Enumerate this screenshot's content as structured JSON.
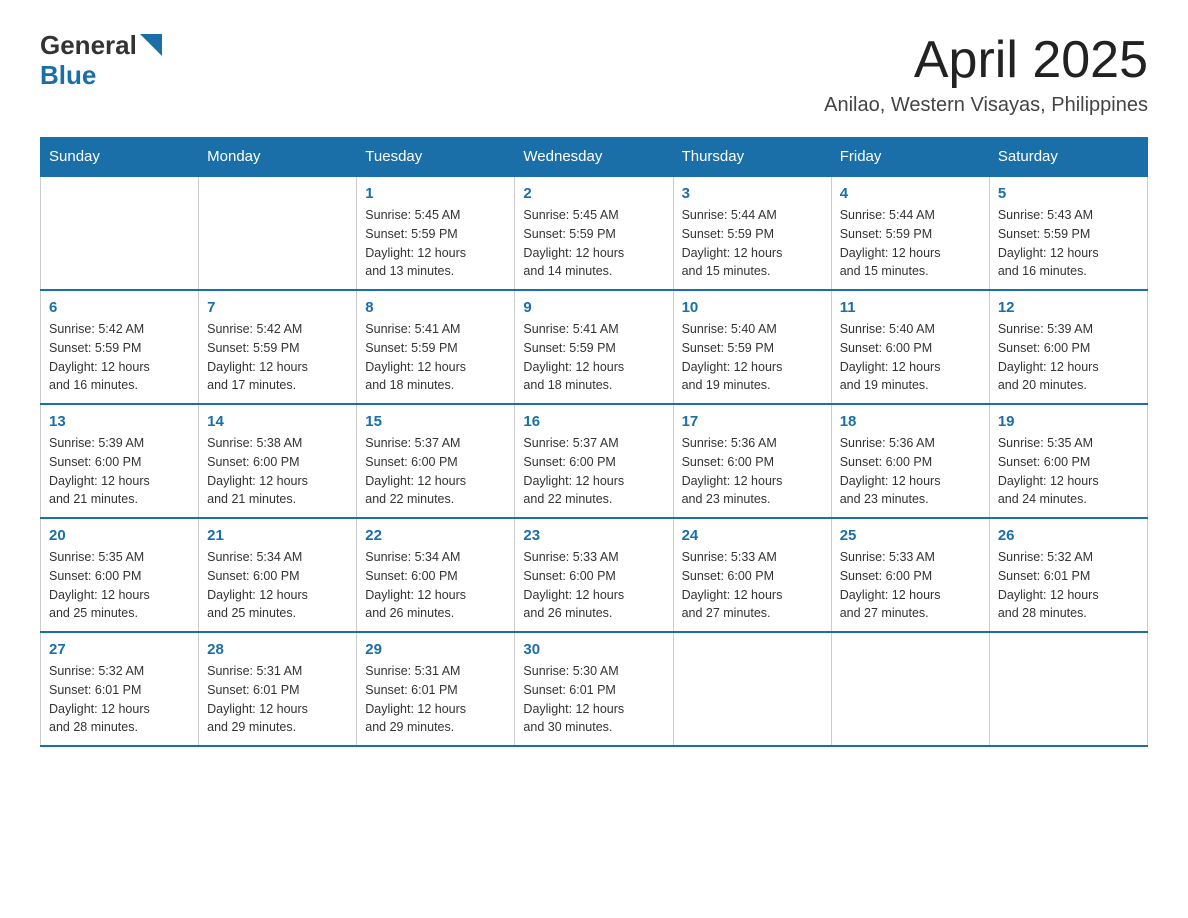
{
  "header": {
    "logo_general": "General",
    "logo_blue": "Blue",
    "title": "April 2025",
    "subtitle": "Anilao, Western Visayas, Philippines"
  },
  "columns": [
    "Sunday",
    "Monday",
    "Tuesday",
    "Wednesday",
    "Thursday",
    "Friday",
    "Saturday"
  ],
  "weeks": [
    [
      {
        "day": "",
        "info": ""
      },
      {
        "day": "",
        "info": ""
      },
      {
        "day": "1",
        "info": "Sunrise: 5:45 AM\nSunset: 5:59 PM\nDaylight: 12 hours\nand 13 minutes."
      },
      {
        "day": "2",
        "info": "Sunrise: 5:45 AM\nSunset: 5:59 PM\nDaylight: 12 hours\nand 14 minutes."
      },
      {
        "day": "3",
        "info": "Sunrise: 5:44 AM\nSunset: 5:59 PM\nDaylight: 12 hours\nand 15 minutes."
      },
      {
        "day": "4",
        "info": "Sunrise: 5:44 AM\nSunset: 5:59 PM\nDaylight: 12 hours\nand 15 minutes."
      },
      {
        "day": "5",
        "info": "Sunrise: 5:43 AM\nSunset: 5:59 PM\nDaylight: 12 hours\nand 16 minutes."
      }
    ],
    [
      {
        "day": "6",
        "info": "Sunrise: 5:42 AM\nSunset: 5:59 PM\nDaylight: 12 hours\nand 16 minutes."
      },
      {
        "day": "7",
        "info": "Sunrise: 5:42 AM\nSunset: 5:59 PM\nDaylight: 12 hours\nand 17 minutes."
      },
      {
        "day": "8",
        "info": "Sunrise: 5:41 AM\nSunset: 5:59 PM\nDaylight: 12 hours\nand 18 minutes."
      },
      {
        "day": "9",
        "info": "Sunrise: 5:41 AM\nSunset: 5:59 PM\nDaylight: 12 hours\nand 18 minutes."
      },
      {
        "day": "10",
        "info": "Sunrise: 5:40 AM\nSunset: 5:59 PM\nDaylight: 12 hours\nand 19 minutes."
      },
      {
        "day": "11",
        "info": "Sunrise: 5:40 AM\nSunset: 6:00 PM\nDaylight: 12 hours\nand 19 minutes."
      },
      {
        "day": "12",
        "info": "Sunrise: 5:39 AM\nSunset: 6:00 PM\nDaylight: 12 hours\nand 20 minutes."
      }
    ],
    [
      {
        "day": "13",
        "info": "Sunrise: 5:39 AM\nSunset: 6:00 PM\nDaylight: 12 hours\nand 21 minutes."
      },
      {
        "day": "14",
        "info": "Sunrise: 5:38 AM\nSunset: 6:00 PM\nDaylight: 12 hours\nand 21 minutes."
      },
      {
        "day": "15",
        "info": "Sunrise: 5:37 AM\nSunset: 6:00 PM\nDaylight: 12 hours\nand 22 minutes."
      },
      {
        "day": "16",
        "info": "Sunrise: 5:37 AM\nSunset: 6:00 PM\nDaylight: 12 hours\nand 22 minutes."
      },
      {
        "day": "17",
        "info": "Sunrise: 5:36 AM\nSunset: 6:00 PM\nDaylight: 12 hours\nand 23 minutes."
      },
      {
        "day": "18",
        "info": "Sunrise: 5:36 AM\nSunset: 6:00 PM\nDaylight: 12 hours\nand 23 minutes."
      },
      {
        "day": "19",
        "info": "Sunrise: 5:35 AM\nSunset: 6:00 PM\nDaylight: 12 hours\nand 24 minutes."
      }
    ],
    [
      {
        "day": "20",
        "info": "Sunrise: 5:35 AM\nSunset: 6:00 PM\nDaylight: 12 hours\nand 25 minutes."
      },
      {
        "day": "21",
        "info": "Sunrise: 5:34 AM\nSunset: 6:00 PM\nDaylight: 12 hours\nand 25 minutes."
      },
      {
        "day": "22",
        "info": "Sunrise: 5:34 AM\nSunset: 6:00 PM\nDaylight: 12 hours\nand 26 minutes."
      },
      {
        "day": "23",
        "info": "Sunrise: 5:33 AM\nSunset: 6:00 PM\nDaylight: 12 hours\nand 26 minutes."
      },
      {
        "day": "24",
        "info": "Sunrise: 5:33 AM\nSunset: 6:00 PM\nDaylight: 12 hours\nand 27 minutes."
      },
      {
        "day": "25",
        "info": "Sunrise: 5:33 AM\nSunset: 6:00 PM\nDaylight: 12 hours\nand 27 minutes."
      },
      {
        "day": "26",
        "info": "Sunrise: 5:32 AM\nSunset: 6:01 PM\nDaylight: 12 hours\nand 28 minutes."
      }
    ],
    [
      {
        "day": "27",
        "info": "Sunrise: 5:32 AM\nSunset: 6:01 PM\nDaylight: 12 hours\nand 28 minutes."
      },
      {
        "day": "28",
        "info": "Sunrise: 5:31 AM\nSunset: 6:01 PM\nDaylight: 12 hours\nand 29 minutes."
      },
      {
        "day": "29",
        "info": "Sunrise: 5:31 AM\nSunset: 6:01 PM\nDaylight: 12 hours\nand 29 minutes."
      },
      {
        "day": "30",
        "info": "Sunrise: 5:30 AM\nSunset: 6:01 PM\nDaylight: 12 hours\nand 30 minutes."
      },
      {
        "day": "",
        "info": ""
      },
      {
        "day": "",
        "info": ""
      },
      {
        "day": "",
        "info": ""
      }
    ]
  ]
}
